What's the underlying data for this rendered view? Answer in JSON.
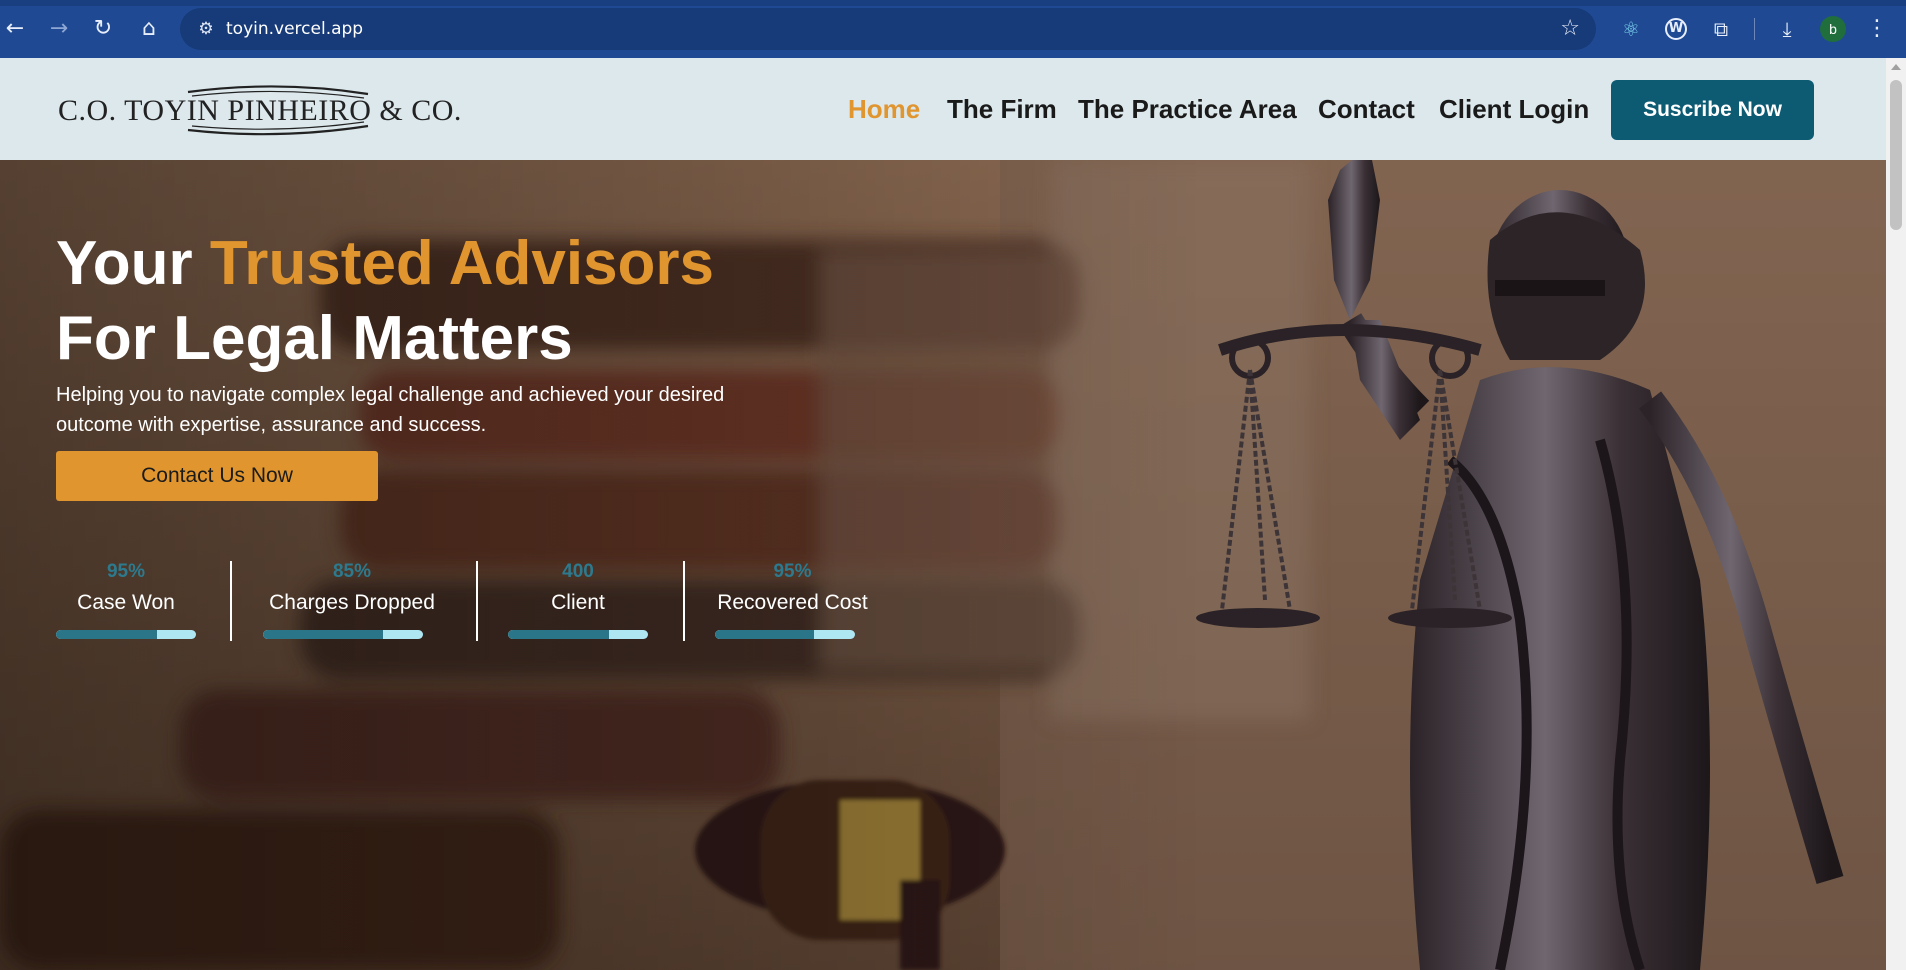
{
  "browser": {
    "url": "toyin.vercel.app",
    "profile_initial": "b",
    "icons": [
      "back-icon",
      "forward-icon",
      "reload-icon",
      "home-icon",
      "site-info-icon",
      "bookmark-star-icon",
      "react-devtools-icon",
      "wappalyzer-icon",
      "extensions-icon",
      "download-icon",
      "profile-avatar",
      "menu-icon"
    ]
  },
  "header": {
    "logo_text": "C.O. TOYIN PINHEIRO & CO.",
    "nav": [
      {
        "label": "Home",
        "active": true
      },
      {
        "label": "The Firm",
        "active": false
      },
      {
        "label": "The Practice Area",
        "active": false
      },
      {
        "label": "Contact",
        "active": false
      },
      {
        "label": "Client Login",
        "active": false
      }
    ],
    "subscribe_label": "Suscribe Now"
  },
  "hero": {
    "headline_part1": "Your ",
    "headline_accent": "Trusted Advisors",
    "headline_line2": "For Legal Matters",
    "subtext": "Helping you to navigate complex legal challenge and achieved your desired outcome with expertise, assurance and success.",
    "cta_label": "Contact Us Now",
    "stats": [
      {
        "value": "95%",
        "label": "Case Won",
        "progress": 0.72
      },
      {
        "value": "85%",
        "label": "Charges Dropped",
        "progress": 0.75
      },
      {
        "value": "400",
        "label": "Client",
        "progress": 0.72
      },
      {
        "value": "95%",
        "label": "Recovered Cost",
        "progress": 0.71
      }
    ]
  },
  "colors": {
    "accent": "#e0952f",
    "brand_teal": "#0d5a73",
    "header_bg": "#dce8ec",
    "chrome_blue": "#1f4a93",
    "stat_value": "#2d7a8e"
  }
}
